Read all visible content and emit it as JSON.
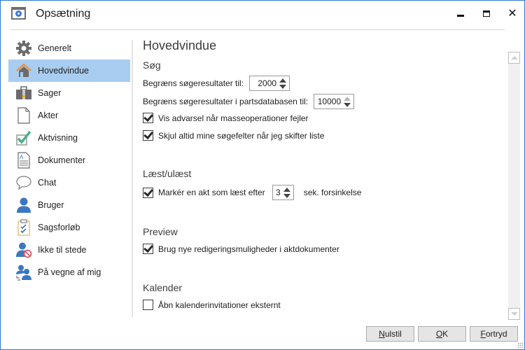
{
  "window": {
    "title": "Opsætning",
    "icon": "settings-window-icon",
    "controls": {
      "minimize": "minimize",
      "maximize": "maximize",
      "close": "✕"
    }
  },
  "sidebar": {
    "selected_index": 1,
    "items": [
      {
        "label": "Generelt",
        "icon": "gear-icon"
      },
      {
        "label": "Hovedvindue",
        "icon": "home-icon"
      },
      {
        "label": "Sager",
        "icon": "briefcase-icon"
      },
      {
        "label": "Akter",
        "icon": "document-icon"
      },
      {
        "label": "Aktvisning",
        "icon": "checkmark-box-icon"
      },
      {
        "label": "Dokumenter",
        "icon": "text-document-icon"
      },
      {
        "label": "Chat",
        "icon": "speech-bubble-icon"
      },
      {
        "label": "Bruger",
        "icon": "user-icon"
      },
      {
        "label": "Sagsforløb",
        "icon": "clipboard-checklist-icon"
      },
      {
        "label": "Ikke til stede",
        "icon": "user-unavailable-icon"
      },
      {
        "label": "På vegne af mig",
        "icon": "user-delegate-icon"
      }
    ]
  },
  "main": {
    "title": "Hovedvindue",
    "sections": {
      "search": {
        "title": "Søg",
        "limit_results_label": "Begræns søgeresultater til:",
        "limit_results_value": "2000",
        "limit_party_label": "Begræns søgeresultater i partsdatabasen til:",
        "limit_party_value": "10000",
        "warn_mass_ops_label": "Vis advarsel når masseoperationer fejler",
        "warn_mass_ops_checked": true,
        "hide_search_fields_label": "Skjul altid mine søgefelter når jeg skifter liste",
        "hide_search_fields_checked": true
      },
      "read": {
        "title": "Læst/ulæst",
        "mark_read_label": "Markér en akt som læst efter",
        "mark_read_checked": true,
        "delay_value": "3",
        "delay_suffix": "sek. forsinkelse"
      },
      "preview": {
        "title": "Preview",
        "new_editing_label": "Brug nye redigeringsmuligheder i aktdokumenter",
        "new_editing_checked": true
      },
      "calendar": {
        "title": "Kalender",
        "open_external_label": "Åbn kalenderinvitationer eksternt",
        "open_external_checked": false
      }
    }
  },
  "footer": {
    "reset": {
      "accel": "N",
      "rest": "ulstil"
    },
    "ok": {
      "accel": "O",
      "rest": "K"
    },
    "cancel": {
      "accel": "F",
      "rest": "ortryd"
    }
  },
  "colors": {
    "accent_border": "#2b79d0",
    "selected_bg": "#a8cdf0"
  }
}
